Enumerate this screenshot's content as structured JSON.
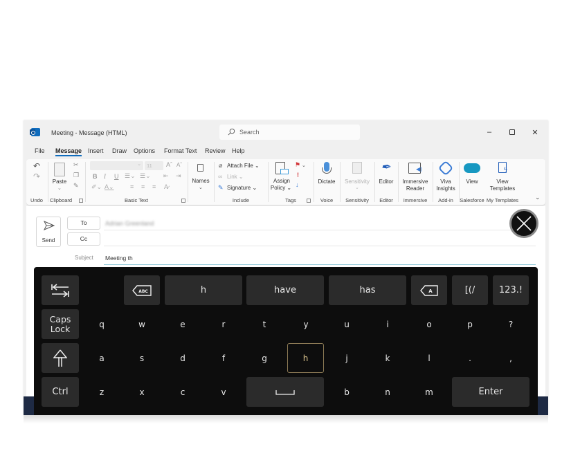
{
  "window": {
    "title": "Meeting  -  Message (HTML)",
    "search_placeholder": "Search",
    "controls": {
      "minimize": "–",
      "maximize": "☐",
      "close": "✕"
    }
  },
  "menu": {
    "items": [
      "File",
      "Message",
      "Insert",
      "Draw",
      "Options",
      "Format Text",
      "Review",
      "Help"
    ],
    "active": "Message"
  },
  "ribbon": {
    "groups": {
      "undo": "Undo",
      "clipboard": "Clipboard",
      "basic_text": "Basic Text",
      "names": "",
      "include": "Include",
      "tags": "Tags",
      "voice": "Voice",
      "sensitivity": "Sensitivity",
      "editor": "Editor",
      "immersive": "Immersive",
      "addin": "Add-in",
      "salesforce": "Salesforce",
      "my_templates": "My Templates"
    },
    "buttons": {
      "paste": "Paste",
      "font_size": "11",
      "bold": "B",
      "italic": "I",
      "underline": "U",
      "grow_font": "Aˆ",
      "shrink_font": "Aˇ",
      "names": "Names",
      "attach_file": "Attach File",
      "link": "Link",
      "signature": "Signature",
      "assign_policy_1": "Assign",
      "assign_policy_2": "Policy",
      "dictate": "Dictate",
      "sensitivity": "Sensitivity",
      "editor": "Editor",
      "immersive_reader_1": "Immersive",
      "immersive_reader_2": "Reader",
      "viva_insights_1": "Viva",
      "viva_insights_2": "Insights",
      "view": "View",
      "view_templates_1": "View",
      "view_templates_2": "Templates"
    }
  },
  "compose": {
    "send_label": "Send",
    "to_label": "To",
    "cc_label": "Cc",
    "to_value": "Adrian Greenland",
    "cc_value": "",
    "subject_label": "Subject",
    "subject_value": "Meeting th"
  },
  "keyboard": {
    "suggestions": [
      "h",
      "have",
      "has"
    ],
    "row1": {
      "symbols": "[(/",
      "numbers": "123.!",
      "abc_backspace": "ABC",
      "a_backspace": "A"
    },
    "row2": {
      "caps_1": "Caps",
      "caps_2": "Lock",
      "keys": [
        "q",
        "w",
        "e",
        "r",
        "t",
        "y",
        "u",
        "i",
        "o",
        "p",
        "?"
      ]
    },
    "row3": {
      "keys": [
        "a",
        "s",
        "d",
        "f",
        "g",
        "h",
        "j",
        "k",
        "l",
        ".",
        ","
      ],
      "highlighted": "h"
    },
    "row4": {
      "ctrl": "Ctrl",
      "keys_left": [
        "z",
        "x",
        "c",
        "v"
      ],
      "keys_right": [
        "b",
        "n",
        "m"
      ],
      "enter": "Enter"
    }
  },
  "colors": {
    "accent": "#0f6cbd",
    "keyboard_bg": "#0d0d0d",
    "key_bg": "#2b2b2b",
    "highlight_border": "#8c7a55"
  }
}
